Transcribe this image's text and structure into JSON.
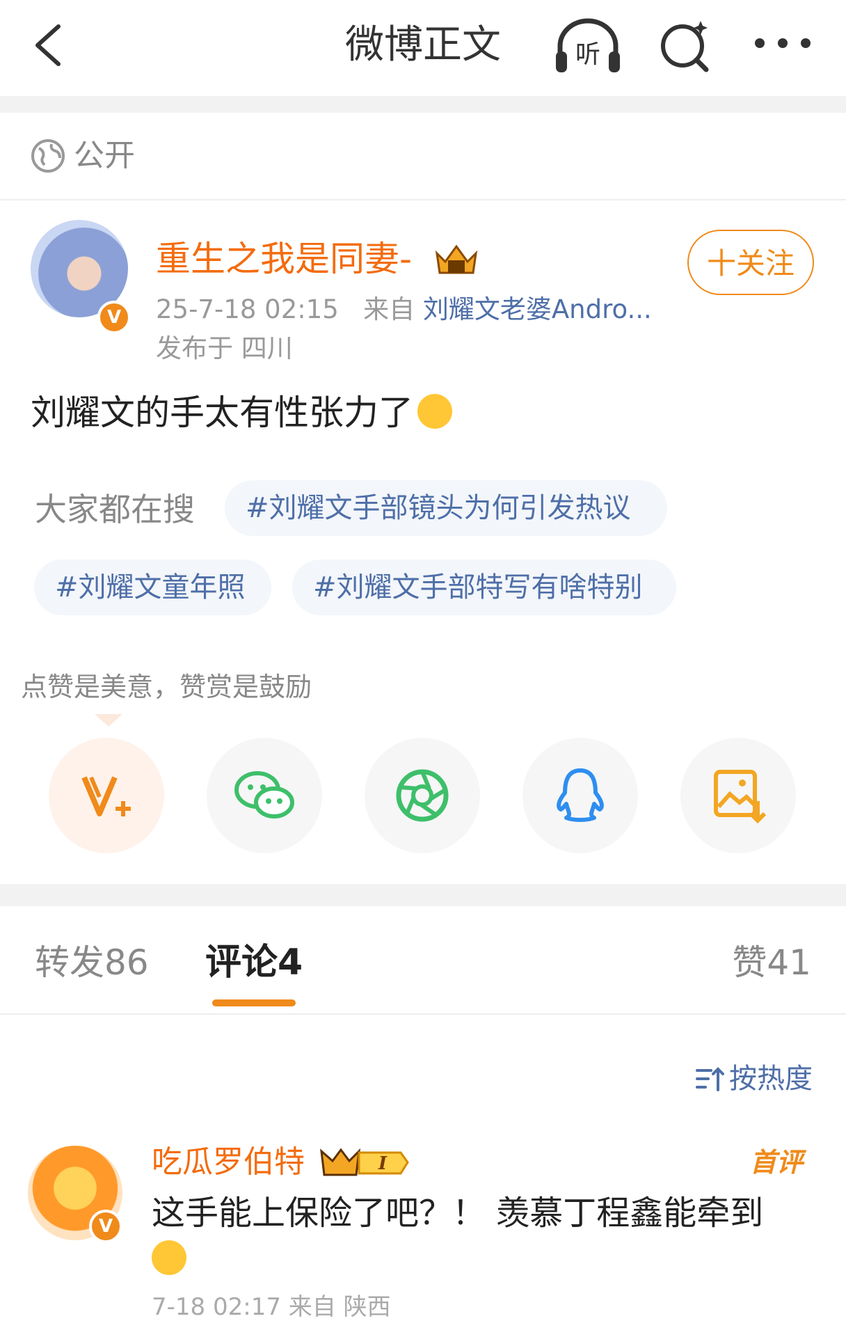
{
  "header": {
    "title": "微博正文",
    "listen_label": "听"
  },
  "visibility": {
    "label": "公开"
  },
  "post": {
    "user_name": "重生之我是同妻-",
    "follow_label": "十关注",
    "time": "25-7-18 02:15",
    "from_prefix": "来自",
    "source": "刘耀文老婆Andro...",
    "location": "发布于 四川",
    "content": "刘耀文的手太有性张力了"
  },
  "searches": {
    "label": "大家都在搜",
    "tags": [
      "#刘耀文手部镜头为何引发热议",
      "#刘耀文童年照",
      "#刘耀文手部特写有啥特别"
    ]
  },
  "reward_hint": "点赞是美意，赞赏是鼓励",
  "share_icons": [
    "reward-v-icon",
    "wechat-icon",
    "moments-icon",
    "qq-icon",
    "save-image-icon"
  ],
  "tabs": {
    "forward": "转发86",
    "comments": "评论4",
    "likes": "赞41"
  },
  "sort_label": "按热度",
  "comment": {
    "user_name": "吃瓜罗伯特",
    "level": "I",
    "first_tag": "首评",
    "text": "这手能上保险了吧？！ 羡慕丁程鑫能牵到",
    "meta": "7-18 02:17 来自 陕西"
  },
  "colors": {
    "accent": "#f08a1a",
    "name": "#f36c0f",
    "link": "#4e6fa8"
  }
}
